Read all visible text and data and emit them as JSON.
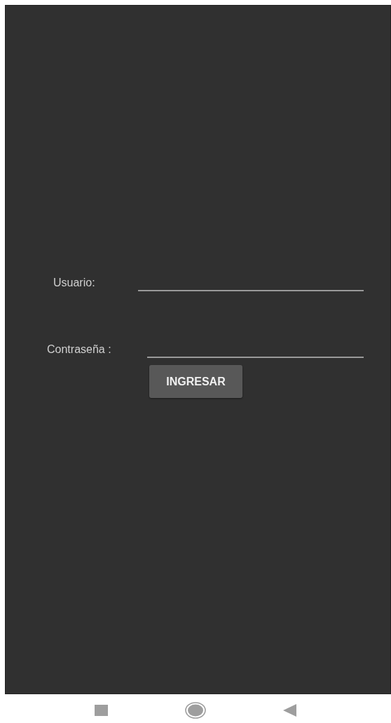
{
  "form": {
    "fields": [
      {
        "label": "Usuario:"
      },
      {
        "label": "Contraseña :"
      }
    ],
    "submit": "INGRESAR"
  },
  "nav_bar": {
    "buttons": [
      {
        "kind": "square"
      },
      {
        "kind": "circle"
      },
      {
        "kind": "triangle"
      }
    ]
  }
}
